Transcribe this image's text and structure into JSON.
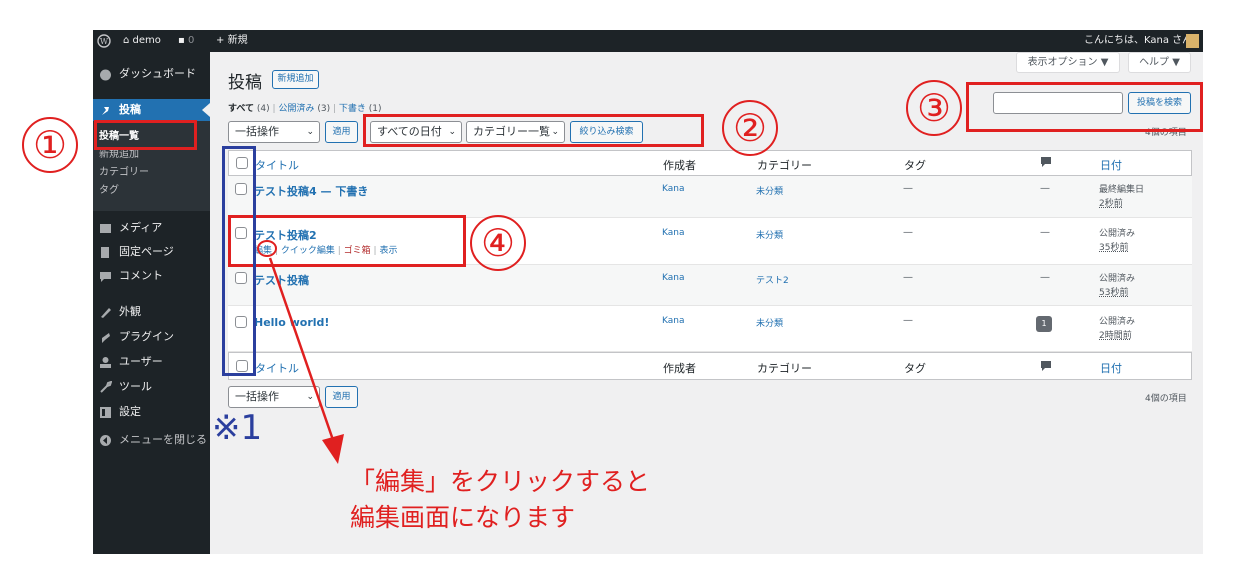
{
  "adminbar": {
    "site_name": "demo",
    "comments_count": "0",
    "new_label": "新規",
    "greeting": "こんにちは、Kana さん"
  },
  "sidebar": {
    "items": [
      {
        "label": "ダッシュボード",
        "icon": "dashboard-icon"
      },
      {
        "label": "投稿",
        "icon": "pin-icon"
      },
      {
        "label": "メディア",
        "icon": "media-icon"
      },
      {
        "label": "固定ページ",
        "icon": "page-icon"
      },
      {
        "label": "コメント",
        "icon": "comment-icon"
      },
      {
        "label": "外観",
        "icon": "brush-icon"
      },
      {
        "label": "プラグイン",
        "icon": "plugin-icon"
      },
      {
        "label": "ユーザー",
        "icon": "user-icon"
      },
      {
        "label": "ツール",
        "icon": "wrench-icon"
      },
      {
        "label": "設定",
        "icon": "settings-icon"
      },
      {
        "label": "メニューを閉じる",
        "icon": "collapse-icon"
      }
    ],
    "submenu": [
      "投稿一覧",
      "新規追加",
      "カテゴリー",
      "タグ"
    ]
  },
  "header": {
    "title": "投稿",
    "add_new": "新規追加",
    "screen_options": "表示オプション ▼",
    "help": "ヘルプ ▼"
  },
  "filters": {
    "all": "すべて",
    "all_count": "(4)",
    "published": "公開済み",
    "published_count": "(3)",
    "draft": "下書き",
    "draft_count": "(1)",
    "sep": "|"
  },
  "actions": {
    "bulk": "一括操作",
    "apply": "適用",
    "dates": "すべての日付",
    "categories": "カテゴリー一覧",
    "filter": "絞り込み検索",
    "search_button": "投稿を検索",
    "search_value": "",
    "items_count": "4個の項目"
  },
  "table": {
    "headers": {
      "title": "タイトル",
      "author": "作成者",
      "category": "カテゴリー",
      "tags": "タグ",
      "date": "日付"
    },
    "rows": [
      {
        "title": "テスト投稿4 — 下書き",
        "author": "Kana",
        "category": "未分類",
        "tags": "—",
        "comments": "—",
        "status": "最終編集日",
        "time": "2秒前"
      },
      {
        "title": "テスト投稿2",
        "author": "Kana",
        "category": "未分類",
        "tags": "—",
        "comments": "—",
        "status": "公開済み",
        "time": "35秒前",
        "row_actions": {
          "edit": "編集",
          "quick": "クイック編集",
          "trash": "ゴミ箱",
          "view": "表示",
          "sep": "|"
        }
      },
      {
        "title": "テスト投稿",
        "author": "Kana",
        "category": "テスト2",
        "tags": "—",
        "comments": "—",
        "status": "公開済み",
        "time": "53秒前"
      },
      {
        "title": "Hello world!",
        "author": "Kana",
        "category": "未分類",
        "tags": "—",
        "comments": "1",
        "status": "公開済み",
        "time": "2時間前"
      }
    ]
  },
  "annotations": {
    "n1": "①",
    "n2": "②",
    "n3": "③",
    "n4": "④",
    "note": "※1",
    "caption_line1": "「編集」をクリックすると",
    "caption_line2": "編集画面になります"
  },
  "colors": {
    "accent": "#2271b1",
    "annotation": "#e02020",
    "note_blue": "#2b3f9e",
    "admin_dark": "#1d2327"
  }
}
